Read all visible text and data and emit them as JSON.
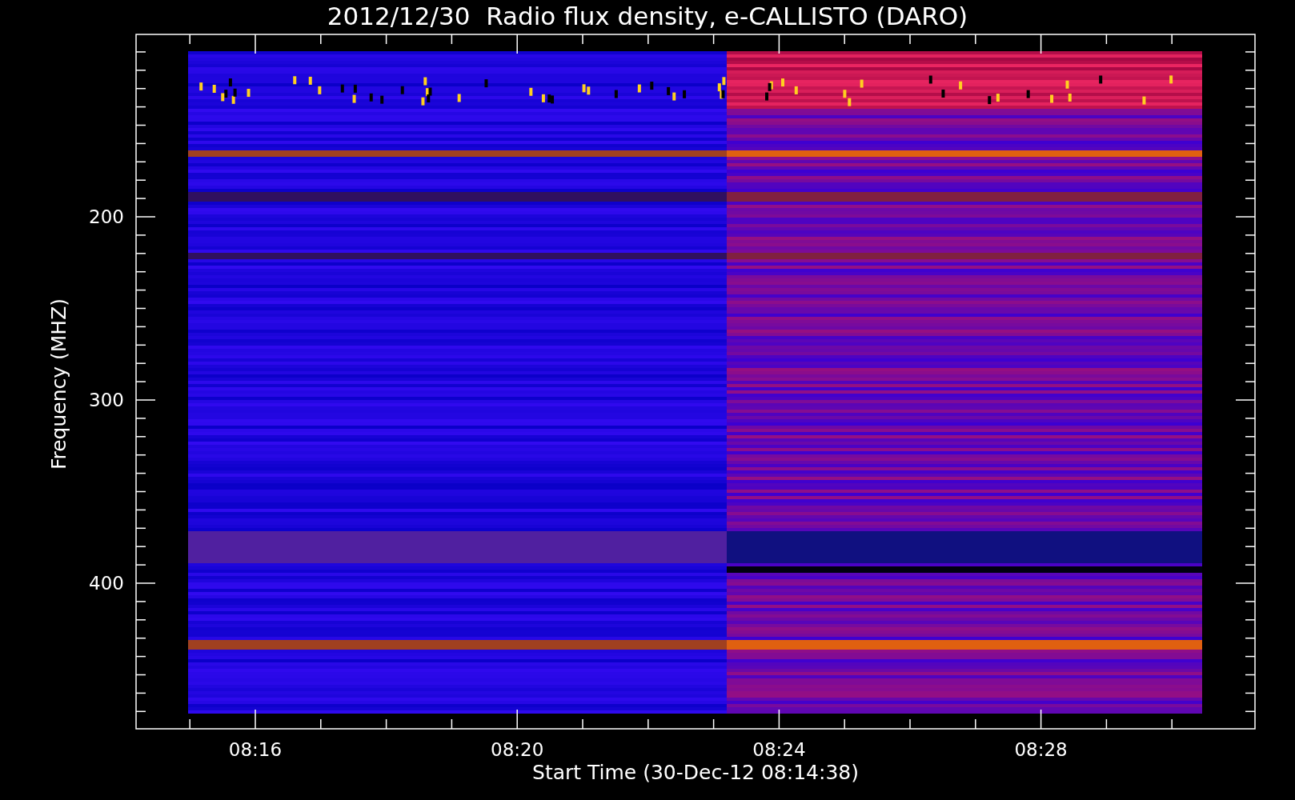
{
  "title": "2012/12/30  Radio flux density, e-CALLISTO (DARO)",
  "xlabel": "Start Time (30-Dec-12 08:14:38)",
  "ylabel": "Frequency (MHZ)",
  "yticks": [
    "200",
    "300",
    "400"
  ],
  "xticks": [
    "08:16",
    "08:20",
    "08:24",
    "08:28"
  ]
}
